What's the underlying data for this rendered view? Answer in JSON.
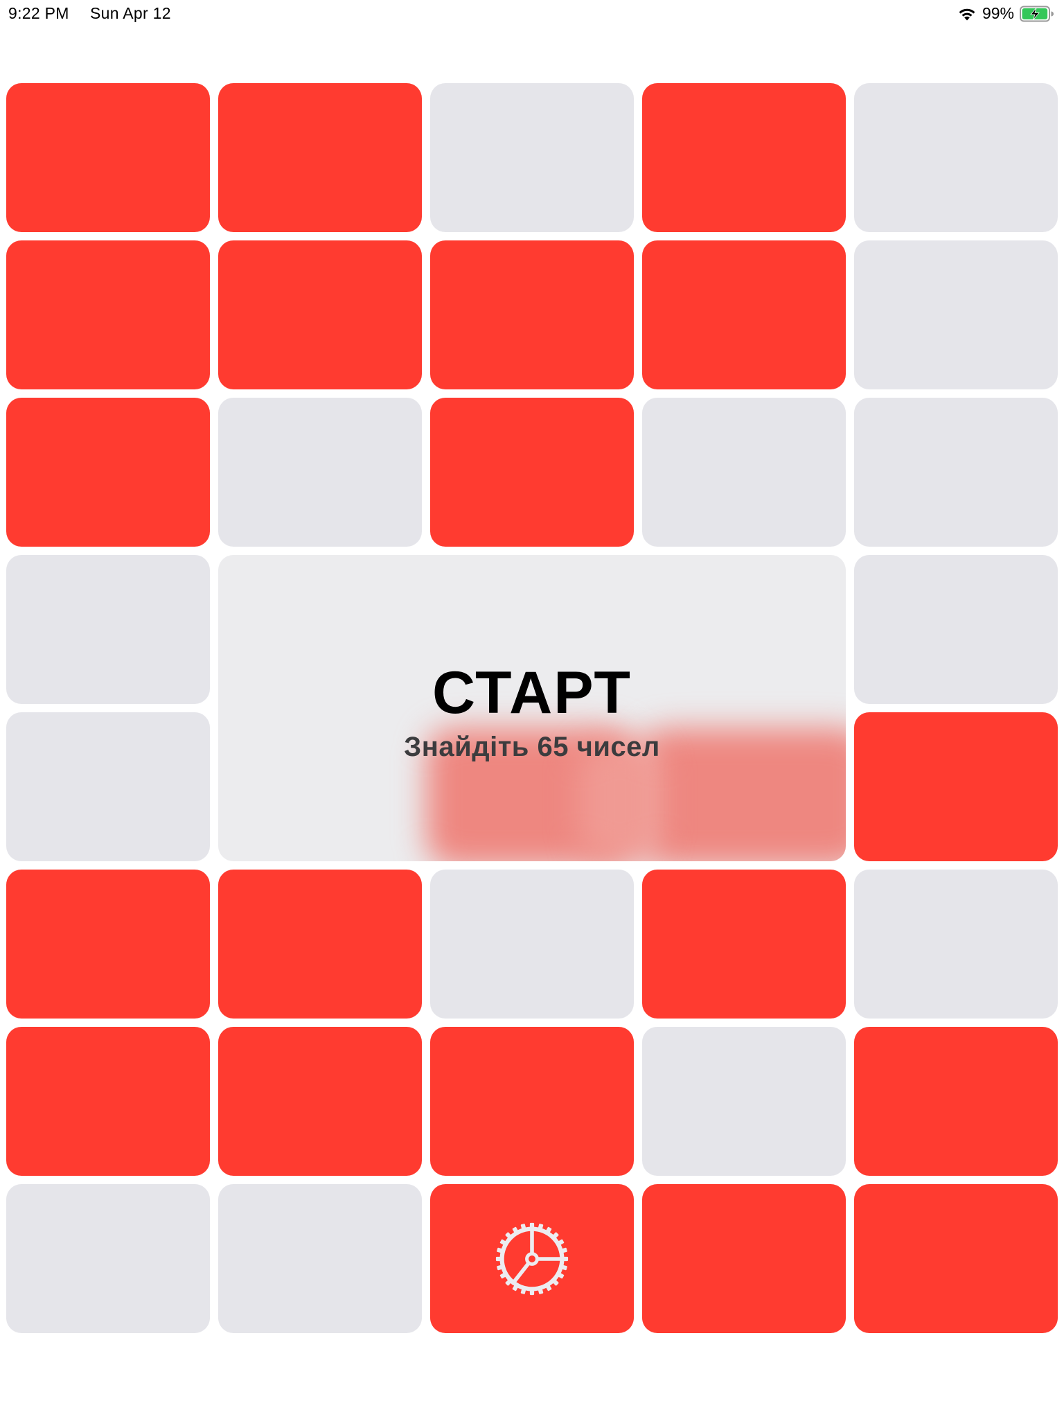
{
  "status_bar": {
    "time": "9:22 PM",
    "date": "Sun Apr 12",
    "battery_percent": "99%",
    "battery_level": 0.99,
    "battery_color": "#34c759",
    "wifi_icon": "wifi-icon",
    "battery_icon": "battery-charging-icon"
  },
  "colors": {
    "red_tile": "#ff3b30",
    "gray_tile": "#e5e5ea",
    "overlay": "#ececee"
  },
  "start_overlay": {
    "title": "СТАРТ",
    "subtitle": "Знайдіть 65 чисел"
  },
  "grid": {
    "columns": 5,
    "rows": 8,
    "tiles": [
      [
        "red",
        "red",
        "gray",
        "red",
        "gray"
      ],
      [
        "red",
        "red",
        "red",
        "red",
        "gray"
      ],
      [
        "red",
        "gray",
        "red",
        "gray",
        "gray"
      ],
      [
        "gray",
        "overlay",
        "overlay",
        "overlay",
        "gray"
      ],
      [
        "gray",
        "overlay",
        "overlay",
        "overlay",
        "red"
      ],
      [
        "red",
        "red",
        "gray",
        "red",
        "gray"
      ],
      [
        "red",
        "red",
        "red",
        "gray",
        "red"
      ],
      [
        "gray",
        "gray",
        "red-settings",
        "red",
        "red"
      ]
    ],
    "settings_icon": "gear-icon"
  }
}
